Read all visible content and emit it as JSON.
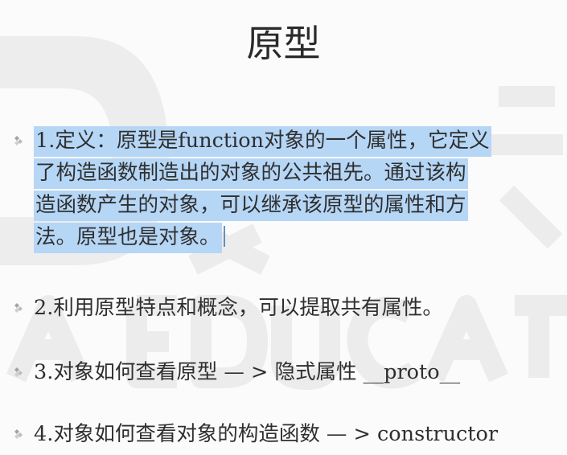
{
  "slide": {
    "title": "原型",
    "bullets": [
      {
        "text_line1": "1.定义：原型是function对象的一个属性，它定义",
        "text_line2": "了构造函数制造出的对象的公共祖先。通过该构",
        "text_line3": "造函数产生的对象，可以继承该原型的属性和方",
        "text_line4": "法。原型也是对象。",
        "selected": true
      },
      {
        "text": "2.利用原型特点和概念，可以提取共有属性。",
        "selected": false
      },
      {
        "text": "3.对象如何查看原型 — > 隐式属性 __proto__",
        "selected": false
      },
      {
        "text": "4.对象如何查看对象的构造函数 — > constructor",
        "selected": false
      }
    ],
    "colors": {
      "selection": "#b6d6f6",
      "text": "#2f2f2f",
      "bullet": "#9a9a9a",
      "watermark": "#ececec"
    },
    "icons": {
      "bullet": "diamond-cluster-bullet-icon"
    }
  }
}
